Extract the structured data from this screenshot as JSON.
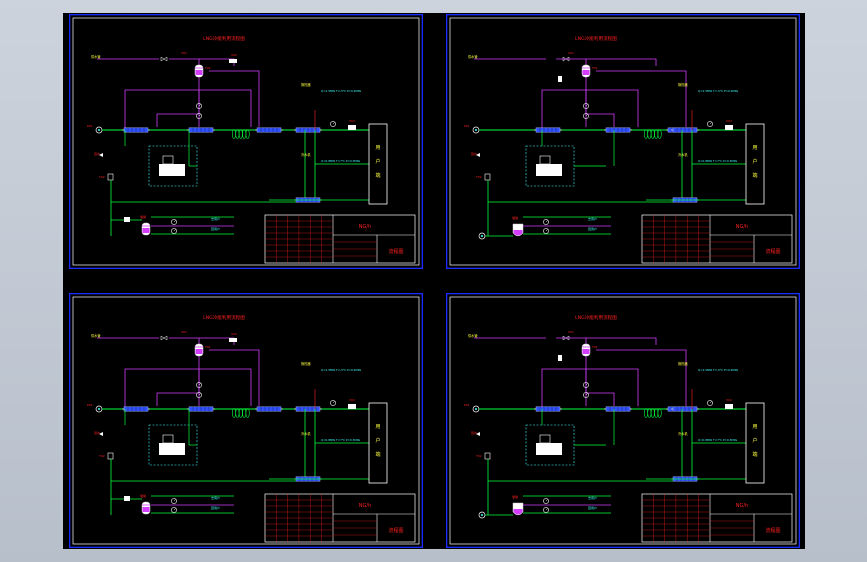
{
  "sheets": [
    {
      "id": "sheet-top-left",
      "variant": "A",
      "title": "LNG冷能利用流程图",
      "tb_title": "流程图",
      "tb_number": "NG/h",
      "tags": {
        "supply": "供水管",
        "v1": "V01",
        "v2": "V02",
        "t1": "T01",
        "t2": "T02",
        "hx1": "换热器",
        "hx2": "冷水机",
        "ret": "回水",
        "spec1": "Q=1.5MW  T=-5℃  P=0.2MPa",
        "spec2": "Q=0.8MW  T=7℃  P=0.3MPa",
        "pump": "P01",
        "tank": "储罐",
        "out1": "去用户",
        "out2": "回用户",
        "box_label": "空调系统"
      }
    },
    {
      "id": "sheet-top-right",
      "variant": "B",
      "title": "LNG冷能利用流程图",
      "tb_title": "流程图",
      "tb_number": "NG/h",
      "tags": {
        "supply": "供水管",
        "v1": "V01",
        "v2": "V02",
        "t1": "T01",
        "t2": "T02",
        "hx1": "换热器",
        "hx2": "冷水机",
        "ret": "回水",
        "spec1": "Q=1.5MW  T=-5℃  P=0.2MPa",
        "spec2": "Q=0.8MW  T=7℃  P=0.3MPa",
        "pump": "P01",
        "tank": "储罐",
        "out1": "去用户",
        "out2": "回用户",
        "box_label": "空调系统"
      }
    },
    {
      "id": "sheet-bottom-left",
      "variant": "A",
      "title": "LNG冷能利用流程图",
      "tb_title": "流程图",
      "tb_number": "NG/h",
      "tags": {
        "supply": "供水管",
        "v1": "V01",
        "v2": "V02",
        "t1": "T01",
        "t2": "T02",
        "hx1": "换热器",
        "hx2": "冷水机",
        "ret": "回水",
        "spec1": "Q=1.5MW  T=-5℃  P=0.2MPa",
        "spec2": "Q=0.8MW  T=7℃  P=0.3MPa",
        "pump": "P01",
        "tank": "储罐",
        "out1": "去用户",
        "out2": "回用户",
        "box_label": "空调系统"
      }
    },
    {
      "id": "sheet-bottom-right",
      "variant": "B",
      "title": "LNG冷能利用流程图",
      "tb_title": "流程图",
      "tb_number": "NG/h",
      "tags": {
        "supply": "供水管",
        "v1": "V01",
        "v2": "V02",
        "t1": "T01",
        "t2": "T02",
        "hx1": "换热器",
        "hx2": "冷水机",
        "ret": "回水",
        "spec1": "Q=1.5MW  T=-5℃  P=0.2MPa",
        "spec2": "Q=0.8MW  T=7℃  P=0.3MPa",
        "pump": "P01",
        "tank": "储罐",
        "out1": "去用户",
        "out2": "回用户",
        "box_label": "空调系统"
      }
    }
  ],
  "colors": {
    "background": "#000000",
    "border_blue": "#1a2cff",
    "frame_white": "#ffffff",
    "pipe_green": "#00ff3c",
    "pipe_magenta": "#d43cff",
    "tag_red": "#ff2020",
    "tag_yellow": "#ffff40",
    "tag_cyan": "#40ffff",
    "equip_blue": "#3050ff"
  }
}
